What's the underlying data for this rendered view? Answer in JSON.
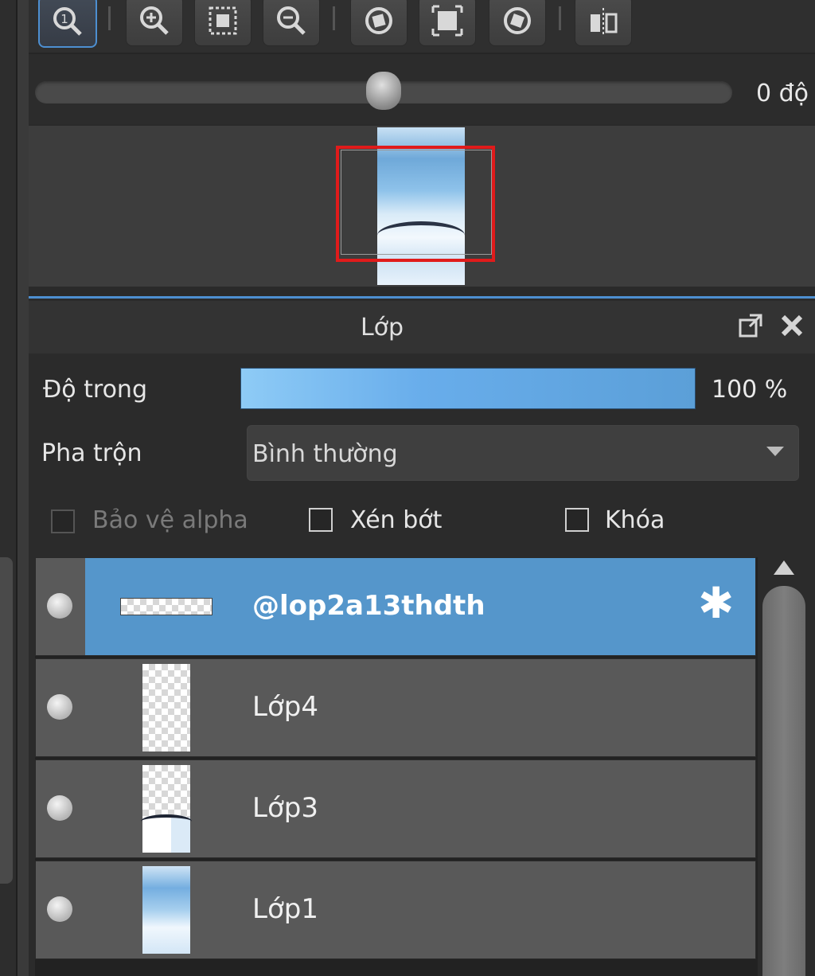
{
  "navigator": {
    "toolbar": [
      {
        "id": "zoom-actual",
        "icon": "zoom-actual-icon"
      },
      {
        "id": "zoom-in",
        "icon": "zoom-in-icon"
      },
      {
        "id": "fit",
        "icon": "fit-screen-icon"
      },
      {
        "id": "zoom-out",
        "icon": "zoom-out-icon"
      },
      {
        "id": "rotate-left",
        "icon": "rotate-left-icon"
      },
      {
        "id": "reset-rotate",
        "icon": "reset-view-icon"
      },
      {
        "id": "rotate-right",
        "icon": "rotate-right-icon"
      },
      {
        "id": "flip",
        "icon": "flip-horizontal-icon"
      }
    ],
    "rotation_value": 0.5,
    "rotation_label": "0 độ"
  },
  "layer_panel": {
    "title": "Lớp",
    "opacity_label": "Độ trong",
    "opacity_value": "100 %",
    "blend_label": "Pha trộn",
    "blend_mode": "Bình thường",
    "checkboxes": {
      "alpha_protect": "Bảo vệ alpha",
      "clip": "Xén bớt",
      "lock": "Khóa"
    },
    "layers": [
      {
        "name": "@lop2a13thdth",
        "selected": true
      },
      {
        "name": "Lớp4",
        "selected": false
      },
      {
        "name": "Lớp3",
        "selected": false
      },
      {
        "name": "Lớp1",
        "selected": false
      }
    ]
  },
  "colors": {
    "accent": "#4d8fd1",
    "selected_row": "#5596cb",
    "frame_red": "#e01b1b"
  }
}
